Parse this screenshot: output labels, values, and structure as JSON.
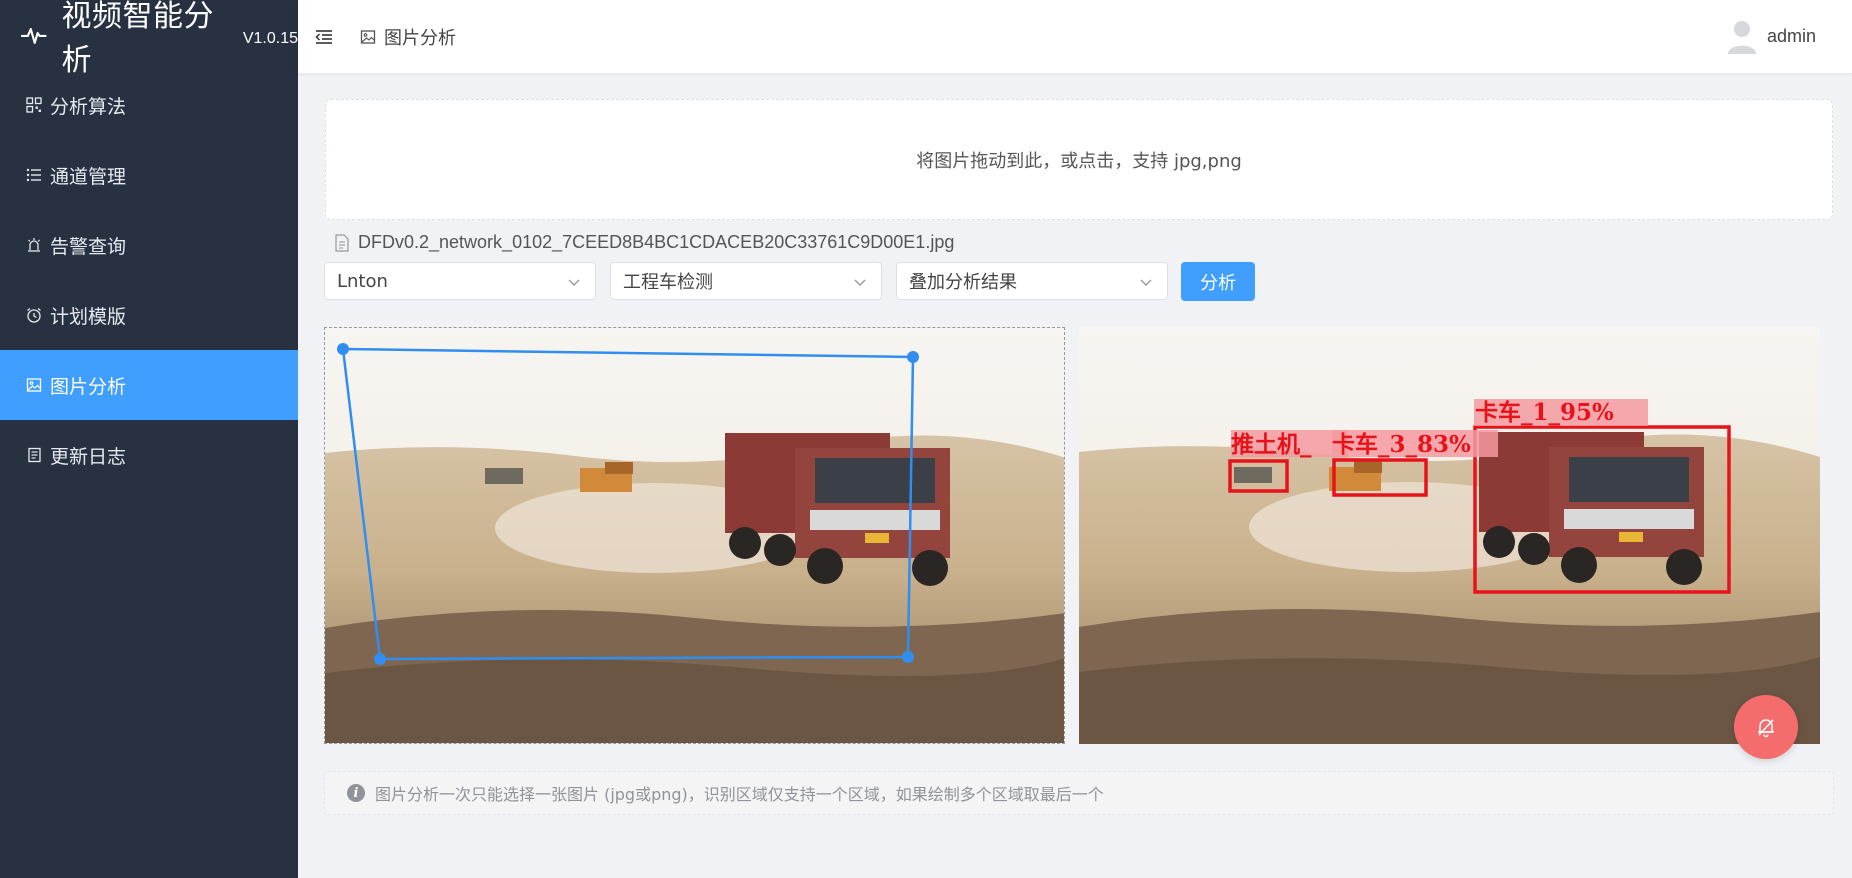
{
  "app": {
    "title": "视频智能分析",
    "version": "V1.0.15"
  },
  "sidebar": {
    "items": [
      {
        "label": "分析算法",
        "icon": "grid-icon"
      },
      {
        "label": "通道管理",
        "icon": "list-icon"
      },
      {
        "label": "告警查询",
        "icon": "alarm-icon"
      },
      {
        "label": "计划模版",
        "icon": "clock-icon"
      },
      {
        "label": "图片分析",
        "icon": "picture-icon",
        "active": true
      },
      {
        "label": "更新日志",
        "icon": "document-icon"
      }
    ],
    "colors": {
      "background": "#273142",
      "active": "#409eff"
    }
  },
  "header": {
    "breadcrumb": "图片分析",
    "user": "admin"
  },
  "upload": {
    "hint": "将图片拖动到此，或点击，支持 jpg,png"
  },
  "file": {
    "name": "DFDv0.2_network_0102_7CEED8B4BC1CDACEB20C33761C9D00E1.jpg"
  },
  "selects": [
    {
      "value": "Lnton"
    },
    {
      "value": "工程车检测"
    },
    {
      "value": "叠加分析结果"
    }
  ],
  "actions": {
    "analyze": "分析"
  },
  "detections": [
    {
      "label": "推土机_",
      "color": "#e8121a"
    },
    {
      "label": "卡车_3_83%",
      "color": "#e8121a"
    },
    {
      "label": "卡车_1_95%",
      "color": "#e8121a"
    }
  ],
  "tip": {
    "text": "图片分析一次只能选择一张图片 (jpg或png)，识别区域仅支持一个区域，如果绘制多个区域取最后一个"
  }
}
